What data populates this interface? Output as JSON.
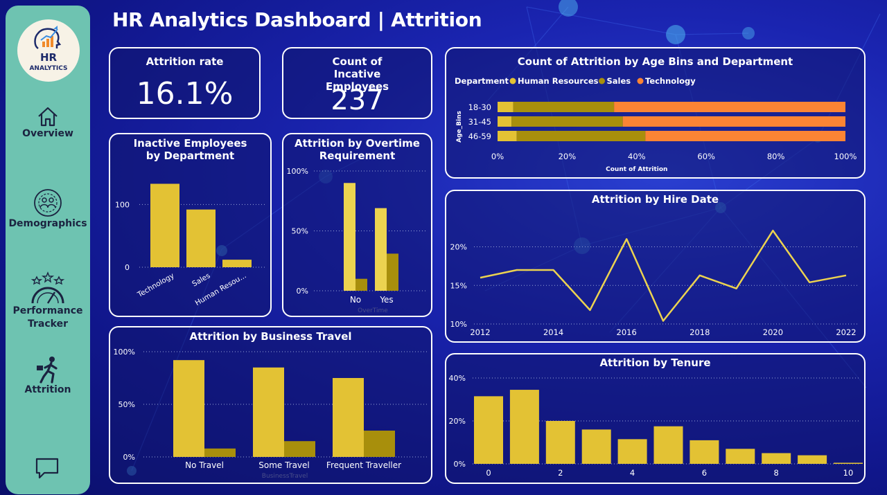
{
  "dashboard": {
    "title": "HR Analytics Dashboard | Attrition"
  },
  "sidebar": {
    "logo": {
      "line1": "HR",
      "line2": "ANALYTICS"
    },
    "items": [
      {
        "label": "Overview",
        "icon": "home-icon"
      },
      {
        "label": "Demographics",
        "icon": "people-circle-icon"
      },
      {
        "label": "Performance Tracker",
        "icon": "gauge-stars-icon"
      },
      {
        "label": "Attrition",
        "icon": "person-leaving-icon"
      }
    ],
    "chat_icon": "chat-icon"
  },
  "kpis": {
    "attrition_rate": {
      "label": "Attrition rate",
      "value": "16.1%"
    },
    "inactive_count": {
      "label": "Count of Incative Employees",
      "value": "237"
    }
  },
  "colors": {
    "yellow": "#e3c234",
    "olive": "#a88f0c",
    "orange": "#fb8434",
    "light_yellow": "#ecd350"
  },
  "chart_data": [
    {
      "id": "inactive_by_department",
      "type": "bar",
      "title": "Inactive Employees by Department",
      "categories": [
        "Technology",
        "Sales",
        "Human Resou..."
      ],
      "values": [
        133,
        92,
        12
      ],
      "ylim": [
        0,
        160
      ],
      "yticks": [
        0,
        100
      ],
      "grid": true
    },
    {
      "id": "attrition_by_overtime",
      "type": "bar",
      "title": "Attrition by Overtime Requirement",
      "xlabel": "OverTime",
      "categories": [
        "No",
        "Yes"
      ],
      "series": [
        {
          "values": [
            90,
            69
          ]
        },
        {
          "values": [
            10,
            31
          ]
        }
      ],
      "ylim": [
        0,
        100
      ],
      "yticks": [
        "0%",
        "50%",
        "100%"
      ],
      "grid": true
    },
    {
      "id": "attrition_by_business_travel",
      "type": "bar",
      "title": "Attrition by Business Travel",
      "xlabel": "BusinessTravel",
      "categories": [
        "No Travel",
        "Some Travel",
        "Frequent Traveller"
      ],
      "series": [
        {
          "values": [
            92,
            85,
            75
          ]
        },
        {
          "values": [
            8,
            15,
            25
          ]
        }
      ],
      "ylim": [
        0,
        100
      ],
      "yticks": [
        "0%",
        "50%",
        "100%"
      ],
      "grid": true
    },
    {
      "id": "attrition_by_age_department",
      "type": "bar",
      "orientation": "horizontal-stacked-100",
      "title": "Count of Attrition by Age Bins and Department",
      "legend_title": "Department",
      "xlabel": "Count of Attrition",
      "ylabel": "Age_Bins",
      "categories": [
        "18-30",
        "31-45",
        "46-59"
      ],
      "series": [
        {
          "name": "Human Resources",
          "values": [
            4.5,
            4,
            5.5
          ]
        },
        {
          "name": "Sales",
          "values": [
            29,
            32,
            37
          ]
        },
        {
          "name": "Technology",
          "values": [
            66.5,
            64,
            57.5
          ]
        }
      ],
      "xticks": [
        "0%",
        "20%",
        "40%",
        "60%",
        "80%",
        "100%"
      ],
      "legend": "top-left"
    },
    {
      "id": "attrition_by_hire_date",
      "type": "line",
      "title": "Attrition by Hire Date",
      "x": [
        2012,
        2013,
        2014,
        2015,
        2016,
        2017,
        2018,
        2019,
        2020,
        2021,
        2022
      ],
      "values": [
        16.0,
        17.0,
        17.0,
        11.8,
        21.0,
        10.4,
        16.3,
        14.6,
        22.1,
        15.4,
        16.3
      ],
      "ylim": [
        10,
        23
      ],
      "yticks": [
        "10%",
        "15%",
        "20%"
      ],
      "xticks": [
        "2012",
        "2014",
        "2016",
        "2018",
        "2020",
        "2022"
      ],
      "grid": true
    },
    {
      "id": "attrition_by_tenure",
      "type": "bar",
      "title": "Attrition by Tenure",
      "categories": [
        0,
        1,
        2,
        3,
        4,
        5,
        6,
        7,
        8,
        9,
        10
      ],
      "values": [
        31.5,
        34.5,
        20,
        16,
        11.5,
        17.5,
        11,
        7,
        5,
        4,
        0.5
      ],
      "ylim": [
        0,
        44
      ],
      "yticks": [
        "0%",
        "20%",
        "40%"
      ],
      "xticks": [
        "0",
        "2",
        "4",
        "6",
        "8",
        "10"
      ],
      "grid": true
    }
  ]
}
